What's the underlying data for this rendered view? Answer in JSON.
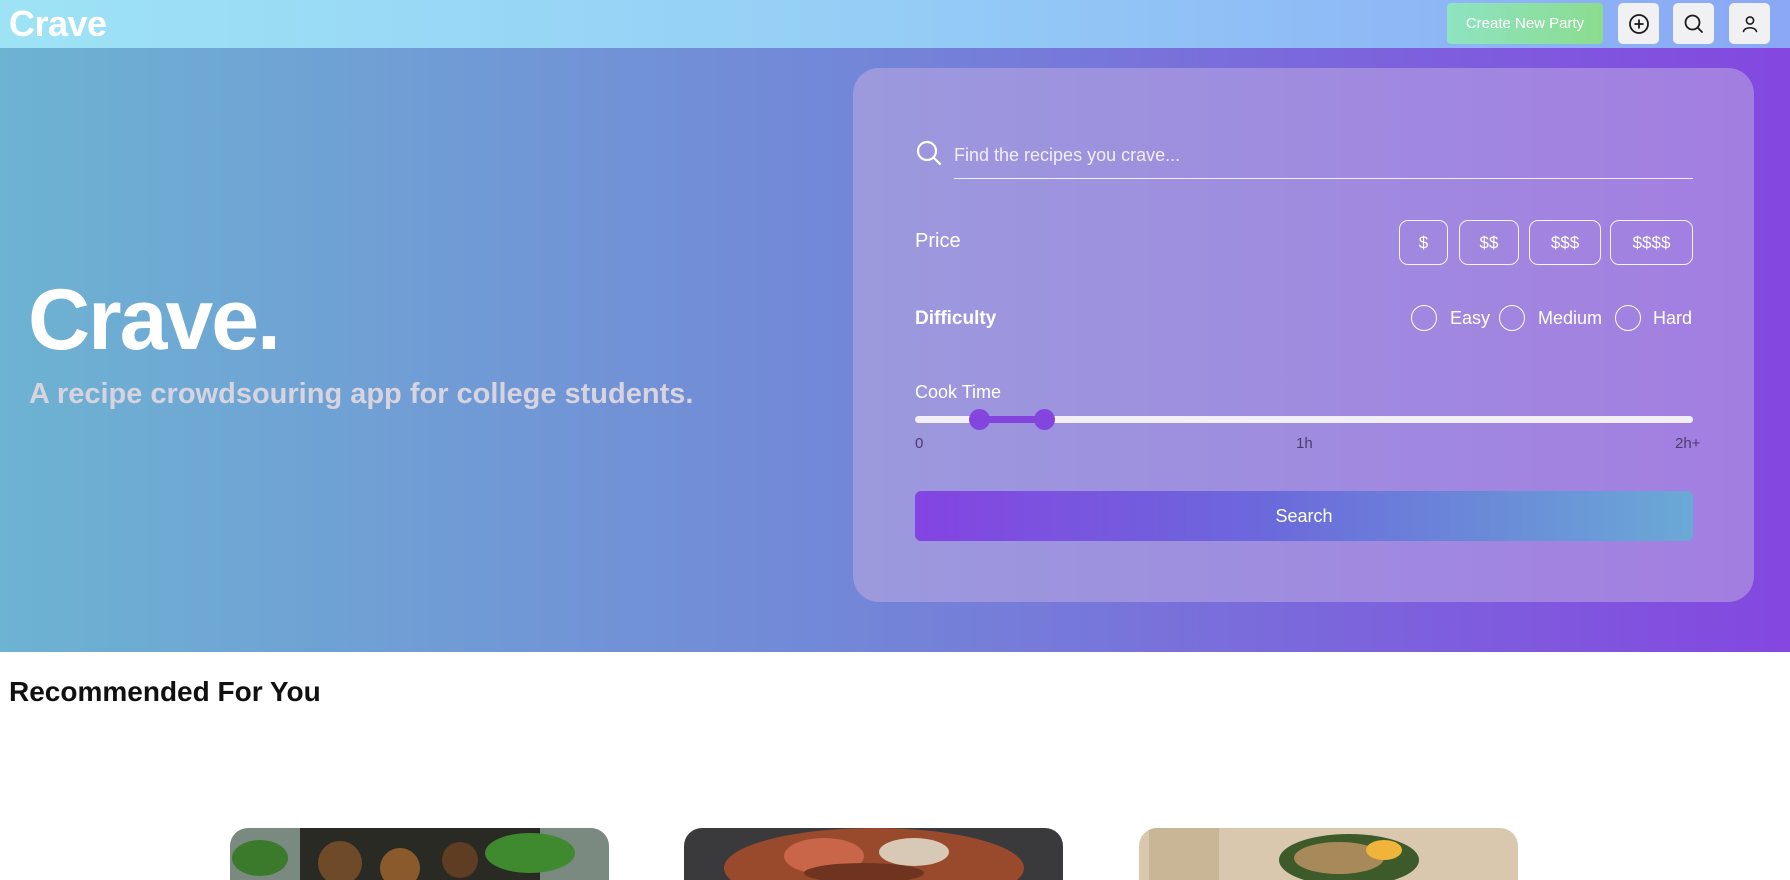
{
  "nav": {
    "brand": "Crave",
    "create_party_label": "Create New Party",
    "icons": [
      "add-circle-icon",
      "search-icon",
      "user-icon"
    ]
  },
  "hero": {
    "title": "Crave.",
    "subtitle": "A recipe crowdsouring app for college students."
  },
  "search": {
    "placeholder": "Find the recipes you crave...",
    "price_label": "Price",
    "price_options": [
      "$",
      "$$",
      "$$$",
      "$$$$"
    ],
    "difficulty_label": "Difficulty",
    "difficulty_options": [
      "Easy",
      "Medium",
      "Hard"
    ],
    "cook_time_label": "Cook Time",
    "cook_time_ticks": [
      "0",
      "1h",
      "2h+"
    ],
    "cook_time_range": [
      0.083,
      0.166
    ],
    "button_label": "Search"
  },
  "recommended": {
    "title": "Recommended For You",
    "cards": [
      {
        "image": "recipe-photo-salad-bowl"
      },
      {
        "image": "recipe-photo-baked-dish"
      },
      {
        "image": "recipe-photo-stuffed-pepper"
      }
    ]
  },
  "colors": {
    "accent_purple": "#8445df",
    "party_button_green": "#8cdc8f",
    "hero_gradient_start": "#6db3d2",
    "hero_gradient_end": "#8447e0"
  }
}
